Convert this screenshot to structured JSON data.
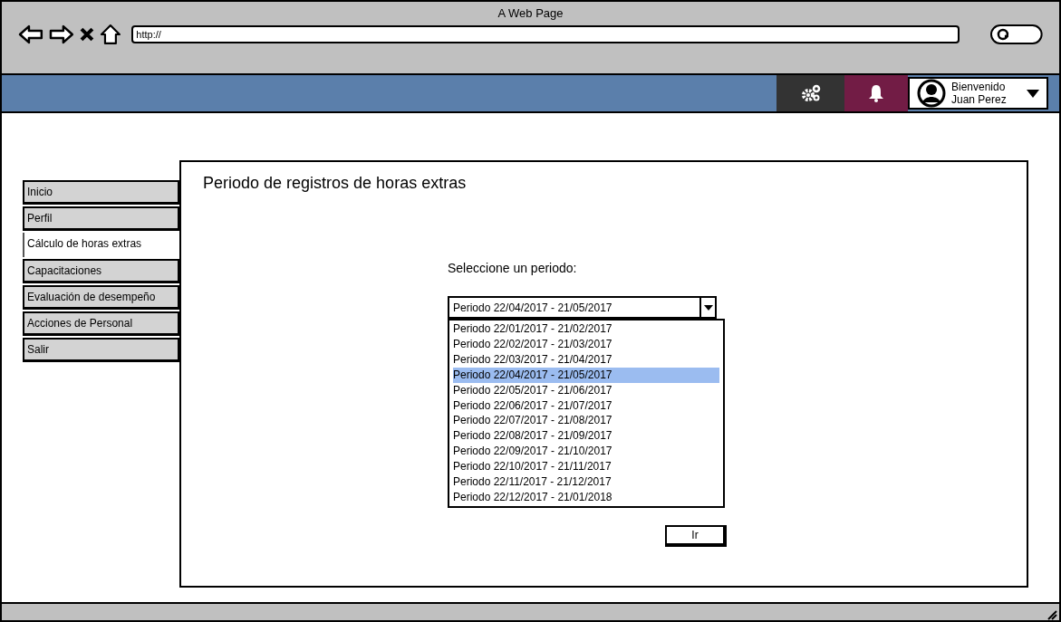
{
  "window": {
    "title": "A Web Page",
    "address": "http://"
  },
  "header": {
    "greeting": "Bienvenido",
    "user": "Juan Perez"
  },
  "sidebar": {
    "items": [
      {
        "label": "Inicio",
        "selected": false
      },
      {
        "label": "Perfil",
        "selected": false
      },
      {
        "label": "Cálculo de horas extras",
        "selected": true
      },
      {
        "label": "Capacitaciones",
        "selected": false
      },
      {
        "label": "Evaluación de desempeño",
        "selected": false
      },
      {
        "label": "Acciones de Personal",
        "selected": false
      },
      {
        "label": "Salir",
        "selected": false
      }
    ]
  },
  "main": {
    "title": "Periodo de registros de horas extras",
    "prompt": "Seleccione un periodo:",
    "dropdown_value": "Periodo 22/04/2017 - 21/05/2017",
    "options": [
      {
        "label": "Periodo 22/01/2017 - 21/02/2017",
        "selected": false
      },
      {
        "label": "Periodo 22/02/2017 - 21/03/2017",
        "selected": false
      },
      {
        "label": "Periodo 22/03/2017 - 21/04/2017",
        "selected": false
      },
      {
        "label": "Periodo 22/04/2017 - 21/05/2017",
        "selected": true
      },
      {
        "label": "Periodo 22/05/2017 - 21/06/2017",
        "selected": false
      },
      {
        "label": "Periodo 22/06/2017 - 21/07/2017",
        "selected": false
      },
      {
        "label": "Periodo 22/07/2017 - 21/08/2017",
        "selected": false
      },
      {
        "label": "Periodo 22/08/2017 - 21/09/2017",
        "selected": false
      },
      {
        "label": "Periodo 22/09/2017 - 21/10/2017",
        "selected": false
      },
      {
        "label": "Periodo 22/10/2017 - 21/11/2017",
        "selected": false
      },
      {
        "label": "Periodo 22/11/2017 - 21/12/2017",
        "selected": false
      },
      {
        "label": "Periodo 22/12/2017 - 21/01/2018",
        "selected": false
      }
    ],
    "button": "Ir"
  }
}
